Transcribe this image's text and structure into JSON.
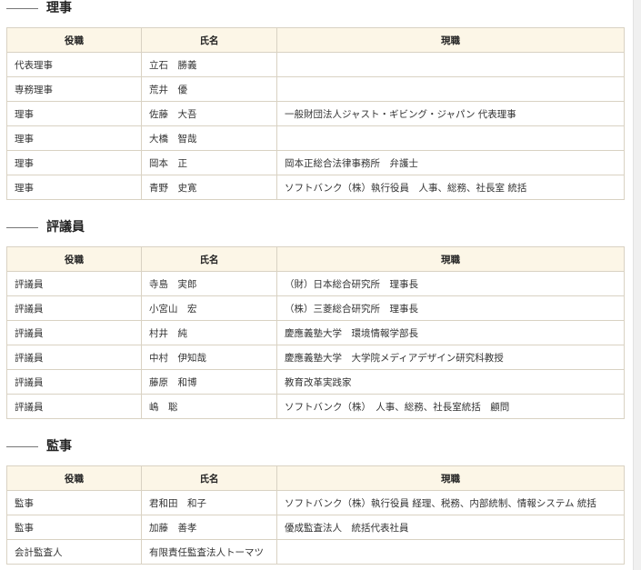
{
  "headers": {
    "role": "役職",
    "name": "氏名",
    "position": "現職"
  },
  "sections": [
    {
      "title": "理事",
      "rows": [
        {
          "role": "代表理事",
          "name": "立石　勝義",
          "position": ""
        },
        {
          "role": "専務理事",
          "name": "荒井　優",
          "position": ""
        },
        {
          "role": "理事",
          "name": "佐藤　大吾",
          "position": "一般財団法人ジャスト・ギビング・ジャパン 代表理事"
        },
        {
          "role": "理事",
          "name": "大橋　智哉",
          "position": ""
        },
        {
          "role": "理事",
          "name": "岡本　正",
          "position": "岡本正総合法律事務所　弁護士"
        },
        {
          "role": "理事",
          "name": "青野　史寛",
          "position": "ソフトバンク（株）執行役員　人事、総務、社長室 統括"
        }
      ]
    },
    {
      "title": "評議員",
      "rows": [
        {
          "role": "評議員",
          "name": "寺島　実郎",
          "position": "（財）日本総合研究所　理事長"
        },
        {
          "role": "評議員",
          "name": "小宮山　宏",
          "position": "（株）三菱総合研究所　理事長"
        },
        {
          "role": "評議員",
          "name": "村井　純",
          "position": "慶應義塾大学　環境情報学部長"
        },
        {
          "role": "評議員",
          "name": "中村　伊知哉",
          "position": "慶應義塾大学　大学院メディアデザイン研究科教授"
        },
        {
          "role": "評議員",
          "name": "藤原　和博",
          "position": "教育改革実践家"
        },
        {
          "role": "評議員",
          "name": "嶋　聡",
          "position": "ソフトバンク（株）　人事、総務、社長室統括　顧問"
        }
      ]
    },
    {
      "title": "監事",
      "rows": [
        {
          "role": "監事",
          "name": "君和田　和子",
          "position": "ソフトバンク（株）執行役員 経理、税務、内部統制、情報システム 統括"
        },
        {
          "role": "監事",
          "name": "加藤　善孝",
          "position": "優成監査法人　統括代表社員"
        },
        {
          "role": "会計監査人",
          "name": "有限責任監査法人トーマツ",
          "position": ""
        }
      ]
    }
  ]
}
